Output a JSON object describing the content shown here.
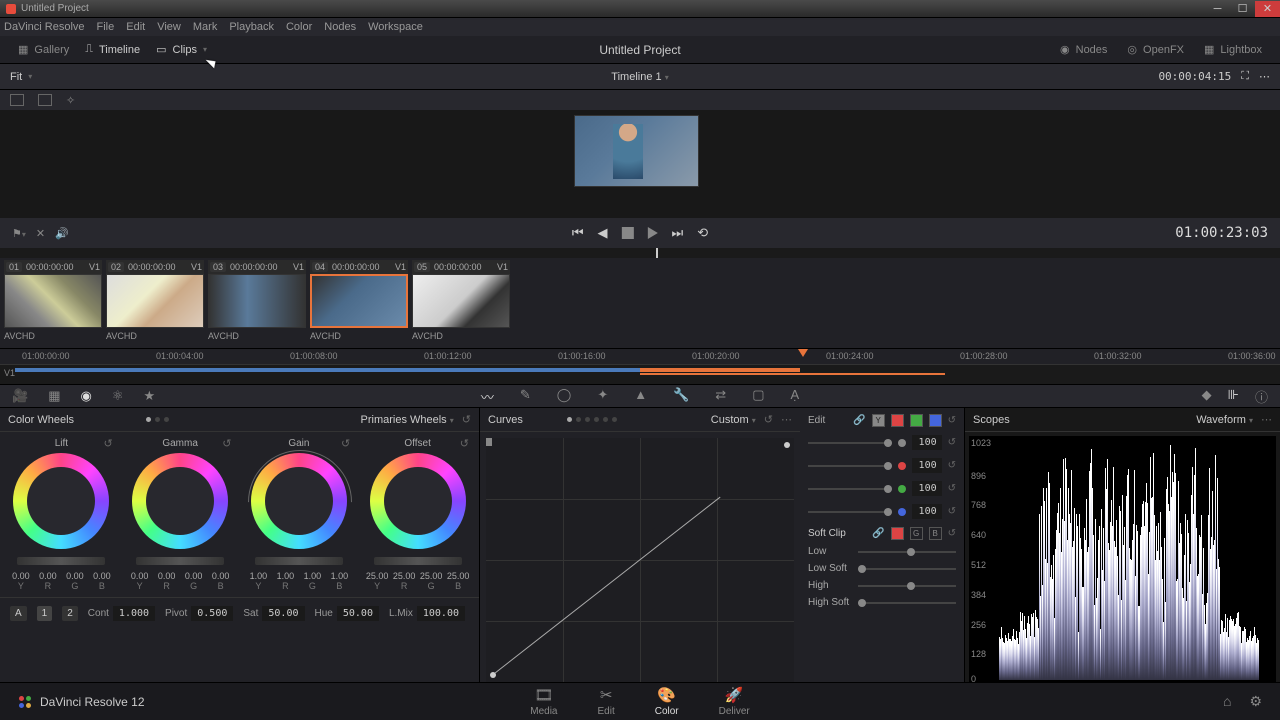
{
  "titlebar": {
    "title": "Untitled Project"
  },
  "menubar": {
    "app": "DaVinci Resolve",
    "items": [
      "File",
      "Edit",
      "View",
      "Mark",
      "Playback",
      "Color",
      "Nodes",
      "Workspace"
    ]
  },
  "topbar": {
    "gallery": "Gallery",
    "timeline": "Timeline",
    "clips": "Clips",
    "project": "Untitled Project",
    "nodes": "Nodes",
    "openfx": "OpenFX",
    "lightbox": "Lightbox"
  },
  "subbar": {
    "fit": "Fit",
    "timeline": "Timeline 1",
    "tc": "00:00:04:15"
  },
  "transport": {
    "tc": "01:00:23:03"
  },
  "clips": [
    {
      "num": "01",
      "tc": "00:00:00:00",
      "track": "V1",
      "label": "AVCHD"
    },
    {
      "num": "02",
      "tc": "00:00:00:00",
      "track": "V1",
      "label": "AVCHD"
    },
    {
      "num": "03",
      "tc": "00:00:00:00",
      "track": "V1",
      "label": "AVCHD"
    },
    {
      "num": "04",
      "tc": "00:00:00:00",
      "track": "V1",
      "label": "AVCHD"
    },
    {
      "num": "05",
      "tc": "00:00:00:00",
      "track": "V1",
      "label": "AVCHD"
    }
  ],
  "ruler": [
    "01:00:00:00",
    "01:00:04:00",
    "01:00:08:00",
    "01:00:12:00",
    "01:00:16:00",
    "01:00:20:00",
    "01:00:24:00",
    "01:00:28:00",
    "01:00:32:00",
    "01:00:36:00"
  ],
  "track": "V1",
  "wheels": {
    "title": "Color Wheels",
    "mode": "Primaries Wheels",
    "items": [
      {
        "name": "Lift",
        "y": "0.00",
        "r": "0.00",
        "g": "0.00",
        "b": "0.00"
      },
      {
        "name": "Gamma",
        "y": "0.00",
        "r": "0.00",
        "g": "0.00",
        "b": "0.00"
      },
      {
        "name": "Gain",
        "y": "1.00",
        "r": "1.00",
        "g": "1.00",
        "b": "1.00"
      },
      {
        "name": "Offset",
        "y": "25.00",
        "r": "25.00",
        "g": "25.00",
        "b": "25.00"
      }
    ],
    "labels": {
      "y": "Y",
      "r": "R",
      "g": "G",
      "b": "B"
    },
    "adj": {
      "a": "A",
      "one": "1",
      "two": "2",
      "cont": "Cont",
      "cont_v": "1.000",
      "pivot": "Pivot",
      "pivot_v": "0.500",
      "sat": "Sat",
      "sat_v": "50.00",
      "hue": "Hue",
      "hue_v": "50.00",
      "lmix": "L.Mix",
      "lmix_v": "100.00"
    }
  },
  "curves": {
    "title": "Curves",
    "mode": "Custom",
    "edit": "Edit",
    "channels": {
      "y": "Y",
      "r": "",
      "g": "",
      "b": ""
    },
    "vals": [
      "100",
      "100",
      "100",
      "100"
    ],
    "softclip": "Soft Clip",
    "sc": {
      "low": "Low",
      "lowsoft": "Low Soft",
      "high": "High",
      "highsoft": "High Soft"
    }
  },
  "scopes": {
    "title": "Scopes",
    "mode": "Waveform",
    "axis": [
      "1023",
      "896",
      "768",
      "640",
      "512",
      "384",
      "256",
      "128",
      "0"
    ]
  },
  "pages": {
    "media": "Media",
    "edit": "Edit",
    "color": "Color",
    "deliver": "Deliver"
  },
  "app": {
    "name": "DaVinci Resolve 12"
  }
}
